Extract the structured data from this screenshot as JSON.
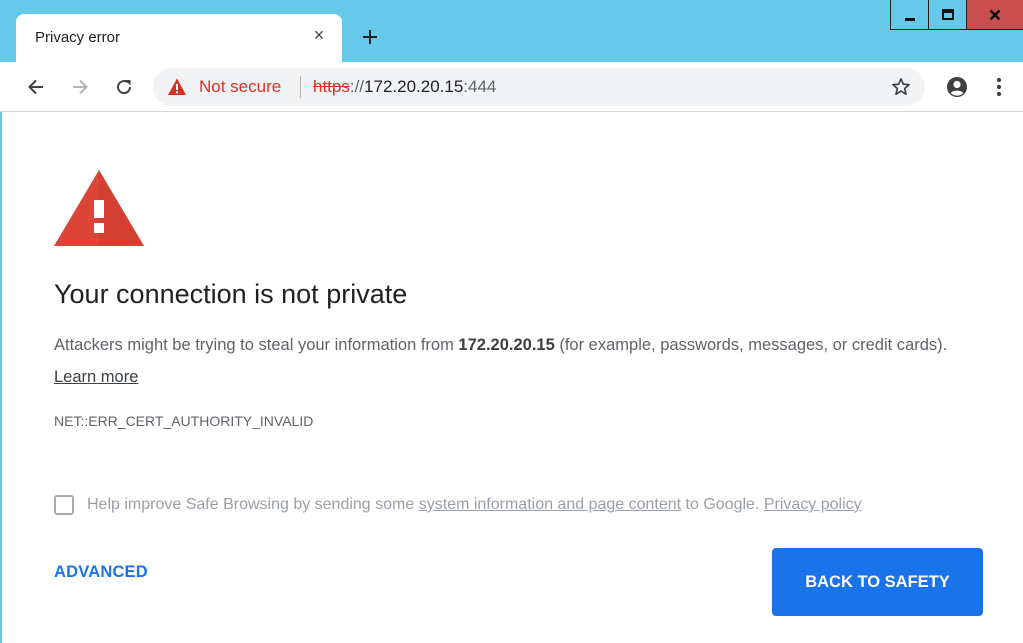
{
  "tab": {
    "title": "Privacy error",
    "close_glyph": "×",
    "new_tab_icon": "plus-icon"
  },
  "window_controls": {
    "icons": [
      "minimize-icon",
      "maximize-icon",
      "close-icon"
    ],
    "close_label": "X"
  },
  "toolbar": {
    "back_icon": "arrow-left-icon",
    "forward_icon": "arrow-right-icon",
    "reload_icon": "reload-icon",
    "security_label": "Not secure",
    "security_icon": "warning-triangle-icon",
    "url": {
      "scheme": "https",
      "separator": "://",
      "host": "172.20.20.15",
      "port": ":444"
    },
    "bookmark_icon": "star-icon",
    "profile_icon": "account-circle-icon",
    "menu_icon": "three-dots-icon"
  },
  "page": {
    "heading": "Your connection is not private",
    "explanation_prefix": "Attackers might be trying to steal your information from ",
    "explanation_host": "172.20.20.15",
    "explanation_suffix": " (for example, passwords, messages, or credit cards). ",
    "learn_more": "Learn more",
    "error_code": "NET::ERR_CERT_AUTHORITY_INVALID",
    "optin_prefix": "Help improve Safe Browsing by sending some ",
    "optin_link": "system information and page content",
    "optin_middle": " to Google. ",
    "privacy_policy": "Privacy policy",
    "optin_checked": false,
    "advanced_label": "ADVANCED",
    "back_to_safety_label": "BACK TO SAFETY"
  },
  "colors": {
    "titlebar": "#66c9ea",
    "error_red": "#d93025",
    "warning_icon_red": "#db4437",
    "primary_blue": "#1a73e8",
    "close_button": "#c94f4f"
  }
}
